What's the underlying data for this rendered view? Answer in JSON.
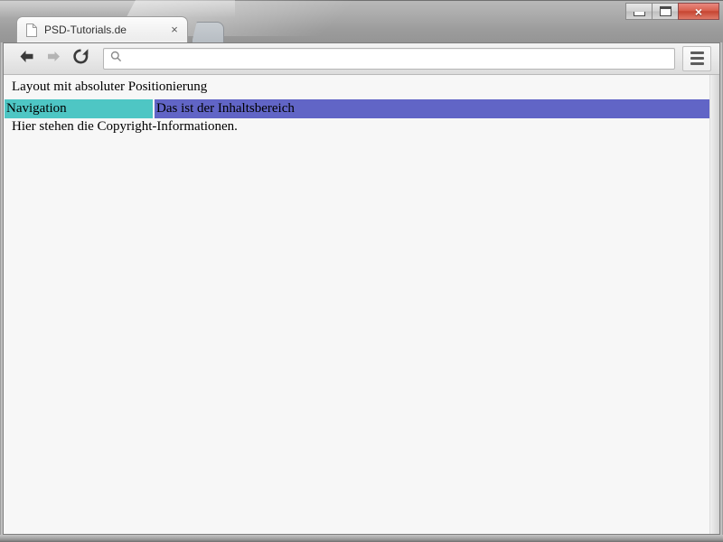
{
  "window": {
    "controls": {
      "minimize_label": "Minimize",
      "maximize_label": "Maximize",
      "close_label": "×"
    }
  },
  "tabstrip": {
    "tabs": [
      {
        "title": "PSD-Tutorials.de",
        "favicon": "page-icon",
        "close_label": "×"
      }
    ],
    "new_tab_label": "New Tab"
  },
  "toolbar": {
    "back_label": "Back",
    "forward_label": "Forward",
    "reload_label": "Reload",
    "menu_label": "Menu",
    "omnibox": {
      "value": "",
      "placeholder": "",
      "icon": "search-icon"
    }
  },
  "page": {
    "header_text": "Layout mit absoluter Positionierung",
    "nav_text": "Navigation",
    "content_text": "Das ist der Inhaltsbereich",
    "footer_text": "Hier stehen die Copyright-Informationen.",
    "colors": {
      "nav_bg": "#4ec6c4",
      "content_bg": "#6165c6",
      "page_bg": "#f7f7f7",
      "text": "#000000"
    }
  }
}
